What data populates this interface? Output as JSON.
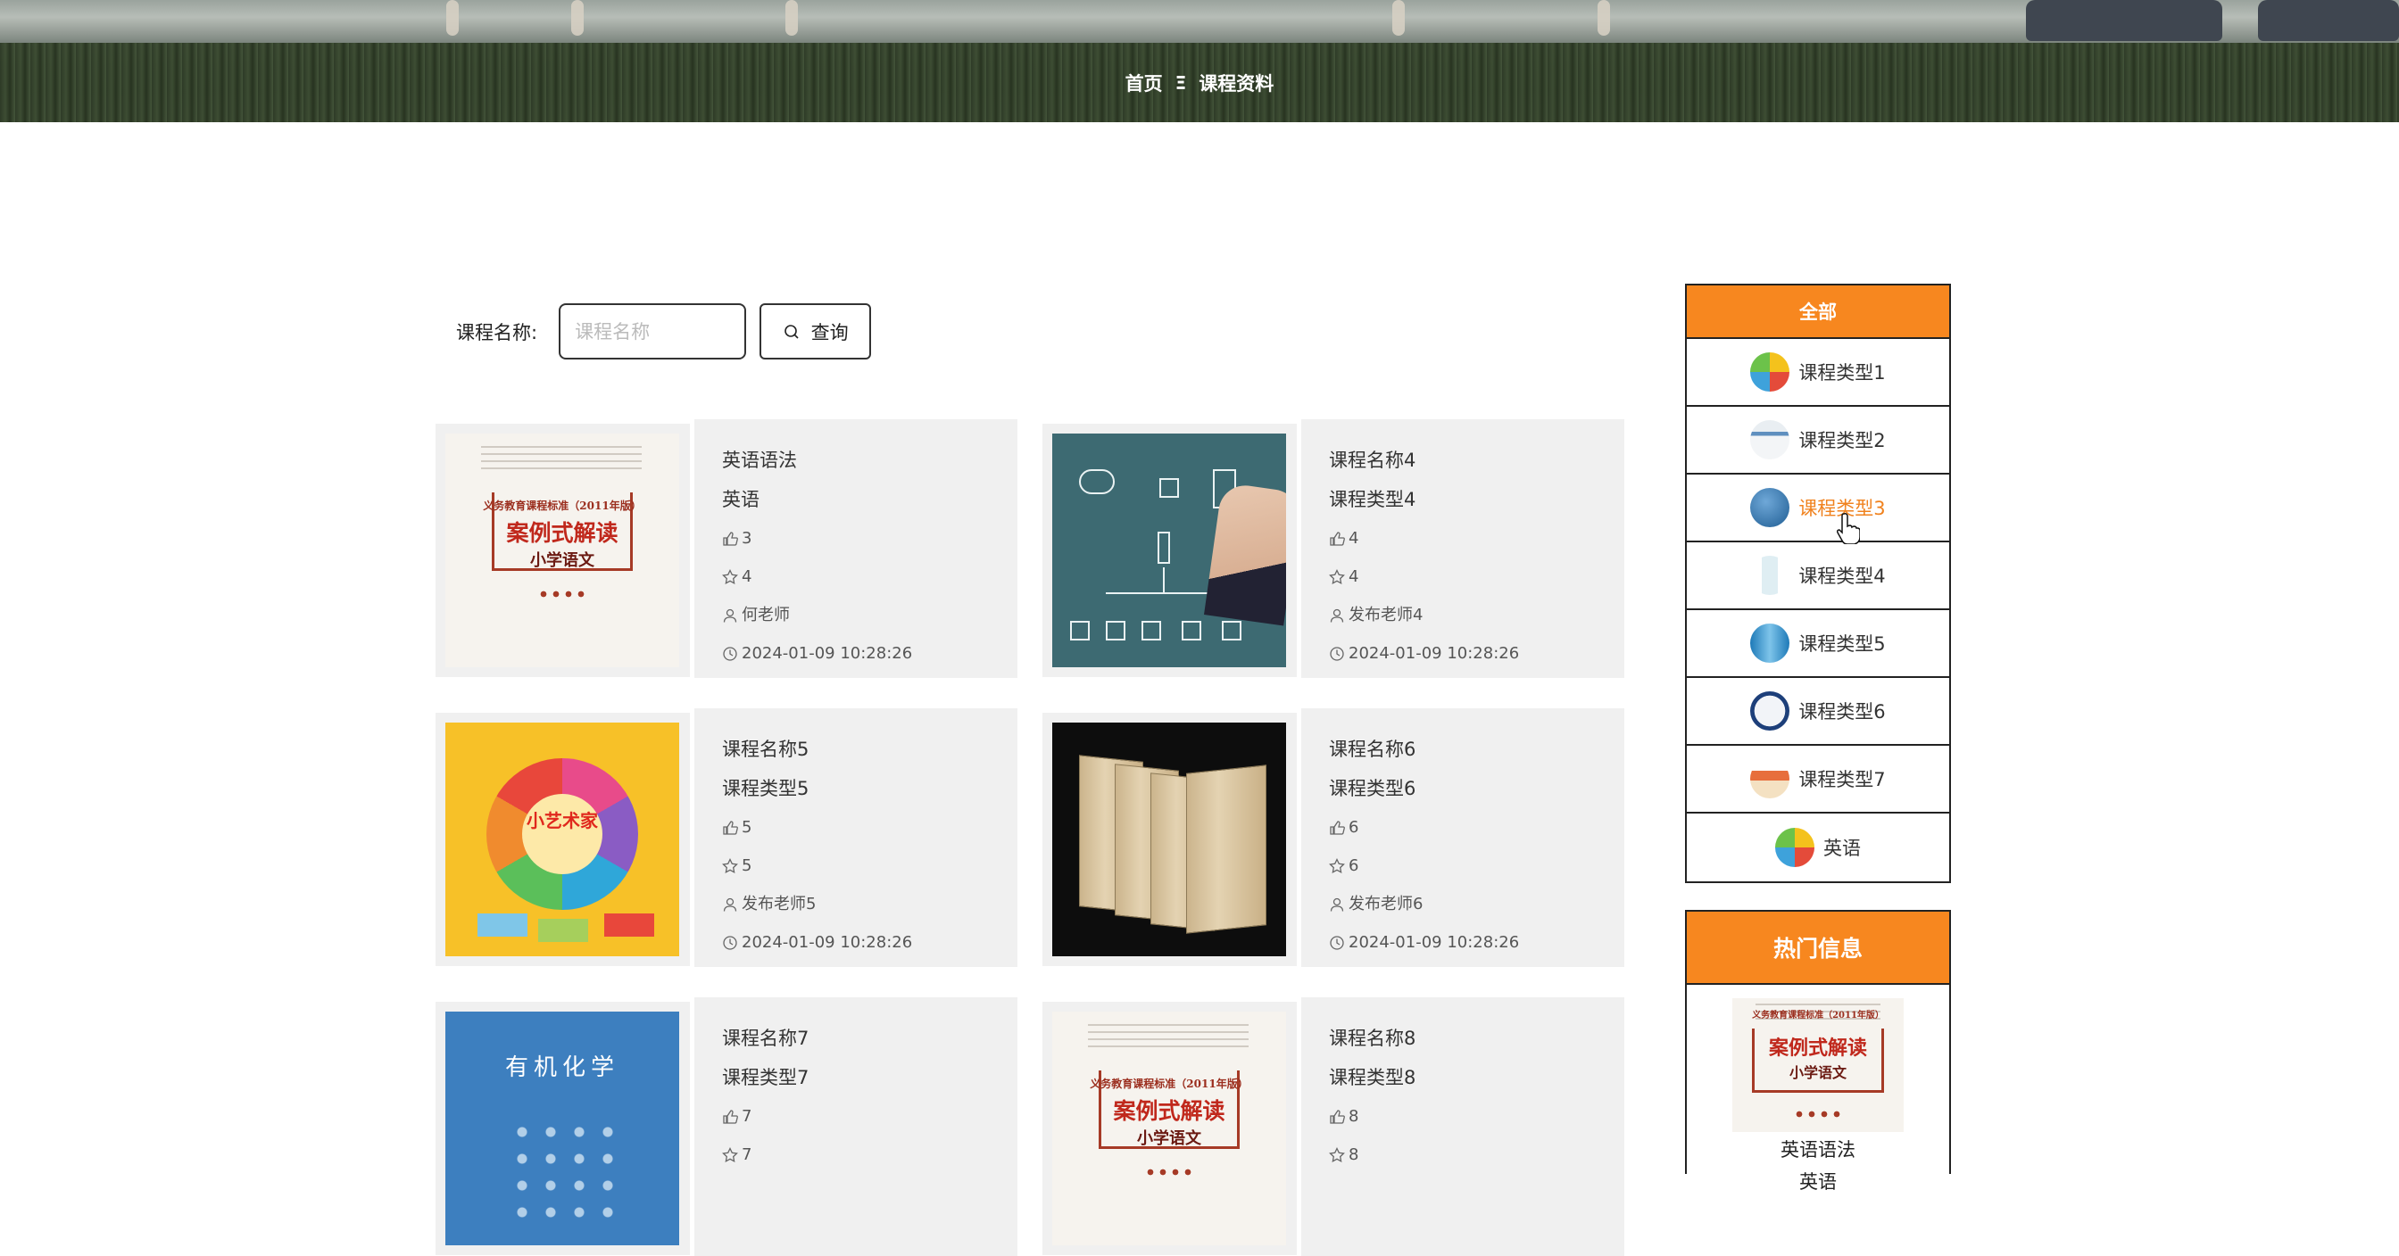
{
  "breadcrumb": {
    "home": "首页",
    "separator": "Ξ",
    "current": "课程资料"
  },
  "search": {
    "label": "课程名称:",
    "placeholder": "课程名称",
    "button_label": "查询"
  },
  "courses": [
    {
      "name": "英语语法",
      "type": "英语",
      "likes": "3",
      "favorites": "4",
      "teacher": "何老师",
      "time": "2024-01-09 10:28:26",
      "cover": "white-book"
    },
    {
      "name": "课程名称4",
      "type": "课程类型4",
      "likes": "4",
      "favorites": "4",
      "teacher": "发布老师4",
      "time": "2024-01-09 10:28:26",
      "cover": "chalkboard"
    },
    {
      "name": "课程名称5",
      "type": "课程类型5",
      "likes": "5",
      "favorites": "5",
      "teacher": "发布老师5",
      "time": "2024-01-09 10:28:26",
      "cover": "yellow-art"
    },
    {
      "name": "课程名称6",
      "type": "课程类型6",
      "likes": "6",
      "favorites": "6",
      "teacher": "发布老师6",
      "time": "2024-01-09 10:28:26",
      "cover": "book-set"
    },
    {
      "name": "课程名称7",
      "type": "课程类型7",
      "likes": "7",
      "favorites": "7",
      "cover": "blue-chemistry"
    },
    {
      "name": "课程名称8",
      "type": "课程类型8",
      "likes": "8",
      "favorites": "8",
      "cover": "white-book"
    }
  ],
  "cover_text": {
    "white_book": {
      "line1": "义务教育课程标准（2011年版）",
      "line2": "案例式解读",
      "line3": "小学语文"
    },
    "yellow_art": {
      "center": "小艺术家"
    },
    "blue_chemistry": {
      "title": "有机化学"
    }
  },
  "categories": {
    "header": "全部",
    "items": [
      {
        "label": "课程类型1",
        "icon": "colorful-circle-icon"
      },
      {
        "label": "课程类型2",
        "icon": "document-icon"
      },
      {
        "label": "课程类型3",
        "icon": "blue-jar-icon",
        "active": true
      },
      {
        "label": "课程类型4",
        "icon": "bottle-icon"
      },
      {
        "label": "课程类型5",
        "icon": "blue-can-icon"
      },
      {
        "label": "课程类型6",
        "icon": "calendar-icon"
      },
      {
        "label": "课程类型7",
        "icon": "box-icon"
      },
      {
        "label": "英语",
        "icon": "colorful-circle-icon"
      }
    ]
  },
  "hot": {
    "header": "热门信息",
    "item_title": "英语语法",
    "item_type": "英语"
  },
  "colors": {
    "accent": "#f7871f",
    "active_text": "#f0821e",
    "card_bg": "#f0f0f0"
  }
}
